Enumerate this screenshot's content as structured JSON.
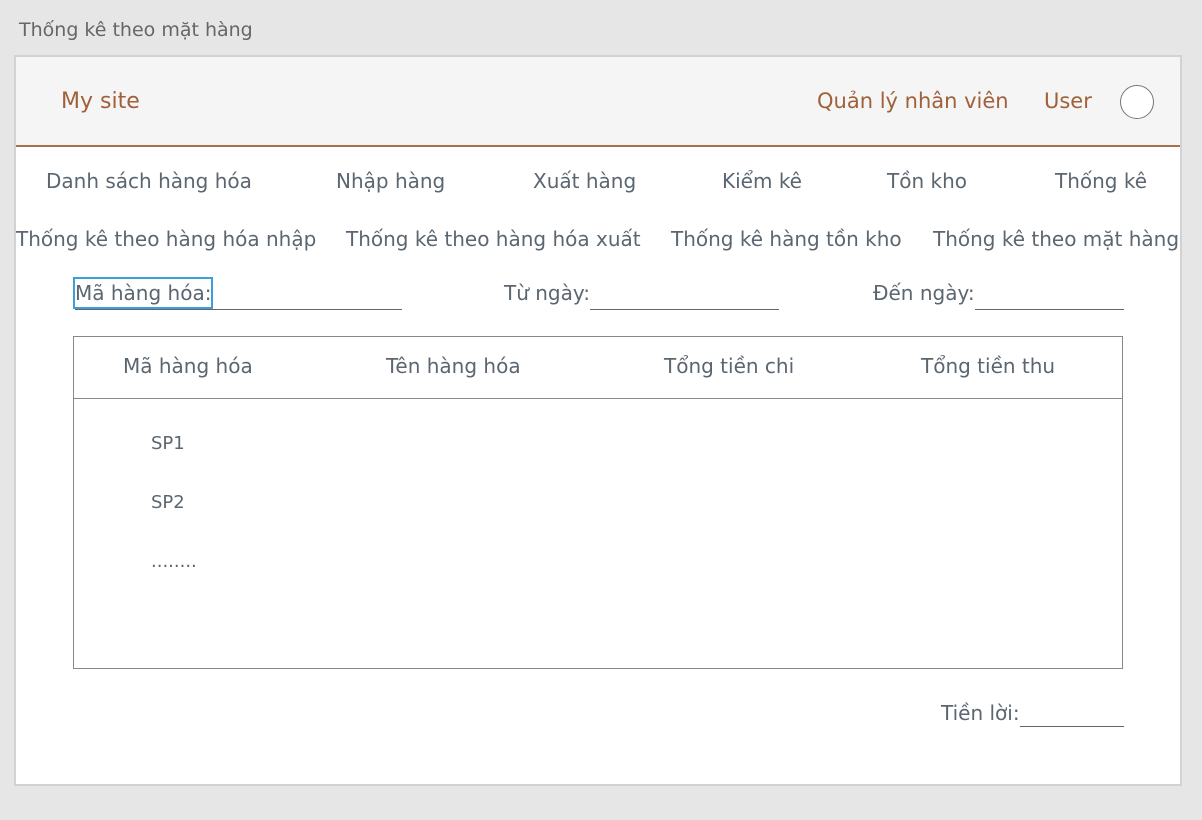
{
  "page_caption": "Thống kê theo mặt hàng",
  "header": {
    "brand": "My site",
    "links": [
      "Quản lý nhân viên",
      "User"
    ]
  },
  "menu": [
    "Danh sách hàng hóa",
    "Nhập hàng",
    "Xuất hàng",
    "Kiểm kê",
    "Tồn kho",
    "Thống kê"
  ],
  "submenu": [
    "Thống kê theo hàng hóa nhập",
    "Thống kê theo hàng hóa xuất",
    "Thống kê hàng tồn kho",
    "Thống kê theo mặt hàng"
  ],
  "filters": {
    "product_code_label": "Mã hàng hóa:",
    "product_code_value": "",
    "from_date_label": "Từ ngày:",
    "from_date_value": "",
    "to_date_label": "Đến ngày:",
    "to_date_value": ""
  },
  "table": {
    "columns": [
      "Mã hàng hóa",
      "Tên hàng hóa",
      "Tổng tiền chi",
      "Tổng tiền thu"
    ],
    "rows": [
      [
        "SP1",
        "",
        "",
        ""
      ],
      [
        "SP2",
        "",
        "",
        ""
      ],
      [
        "........",
        "",
        "",
        ""
      ]
    ]
  },
  "profit": {
    "label": "Tiền lời:",
    "value": ""
  }
}
